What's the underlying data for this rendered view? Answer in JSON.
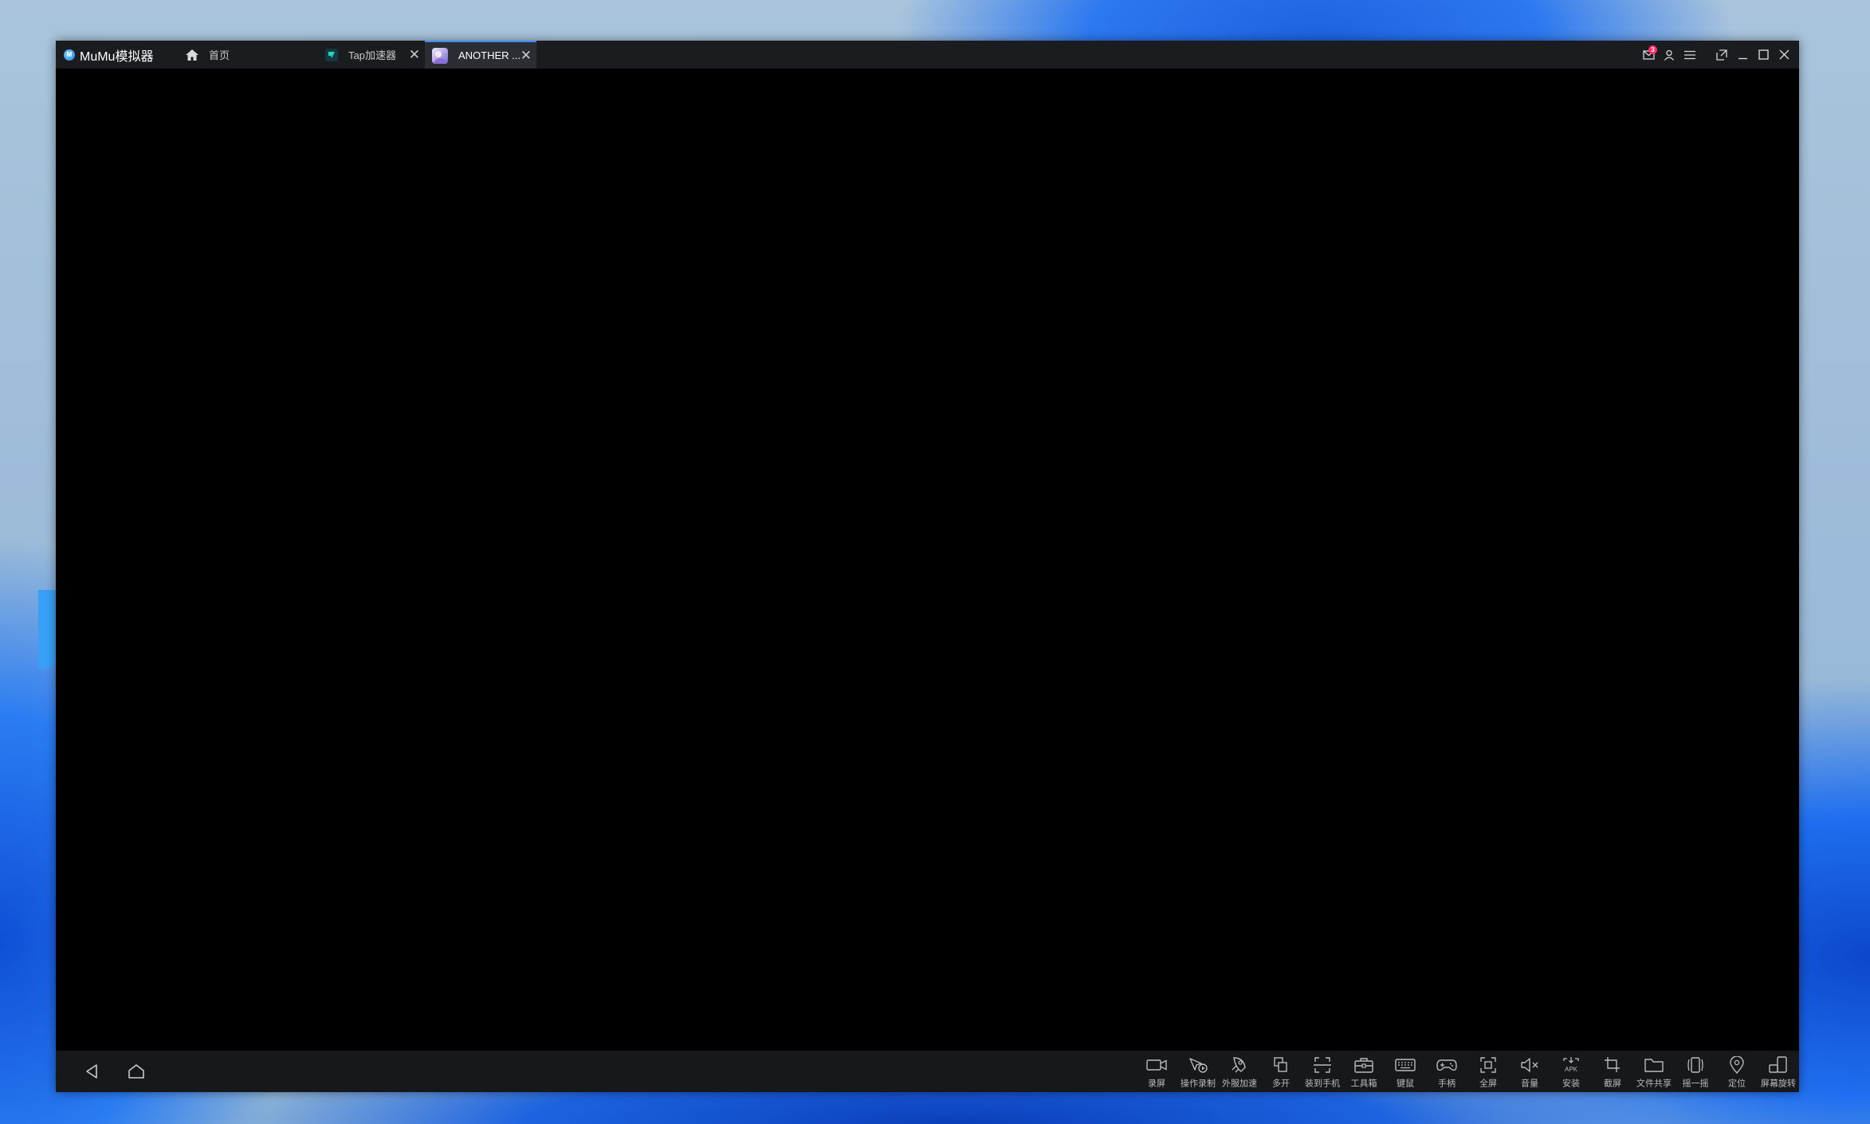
{
  "window": {
    "app_title": "MuMu模拟器",
    "tabs": [
      {
        "label": "首页",
        "active": false,
        "closable": false
      },
      {
        "label": "Tap加速器",
        "active": false,
        "closable": true
      },
      {
        "label": "ANOTHER ...",
        "active": true,
        "closable": true
      }
    ],
    "close_glyph": "✕",
    "notification_count": "3"
  },
  "title_actions": [
    {
      "name": "mail-icon"
    },
    {
      "name": "user-icon"
    },
    {
      "name": "menu-icon"
    },
    {
      "name": "restore-icon"
    },
    {
      "name": "minimize-icon"
    },
    {
      "name": "maximize-icon"
    },
    {
      "name": "close-icon"
    }
  ],
  "toolbar": {
    "tools": [
      {
        "icon": "record-screen-icon",
        "label": "录屏"
      },
      {
        "icon": "macro-record-icon",
        "label": "操作录制"
      },
      {
        "icon": "plugin-accelerate-icon",
        "label": "外服加速"
      },
      {
        "icon": "multi-instance-icon",
        "label": "多开"
      },
      {
        "icon": "install-to-phone-icon",
        "label": "装到手机"
      },
      {
        "icon": "toolbox-icon",
        "label": "工具箱"
      },
      {
        "icon": "keyboard-icon",
        "label": "键鼠"
      },
      {
        "icon": "gamepad-icon",
        "label": "手柄"
      },
      {
        "icon": "fullscreen-icon",
        "label": "全屏"
      },
      {
        "icon": "volume-muted-icon",
        "label": "音量"
      },
      {
        "icon": "apk-install-icon",
        "label": "安装"
      },
      {
        "icon": "screenshot-crop-icon",
        "label": "截屏"
      },
      {
        "icon": "file-share-icon",
        "label": "文件共享"
      },
      {
        "icon": "shake-icon",
        "label": "摇一摇"
      },
      {
        "icon": "location-icon",
        "label": "定位"
      },
      {
        "icon": "rotate-screen-icon",
        "label": "屏幕旋转"
      }
    ]
  },
  "colors": {
    "titlebar": "#1b1c20",
    "active_tab": "#2b2d33",
    "active_tab_accent": "#3d8af7",
    "bottombar": "#17181c",
    "badge": "#ff2d6a"
  }
}
